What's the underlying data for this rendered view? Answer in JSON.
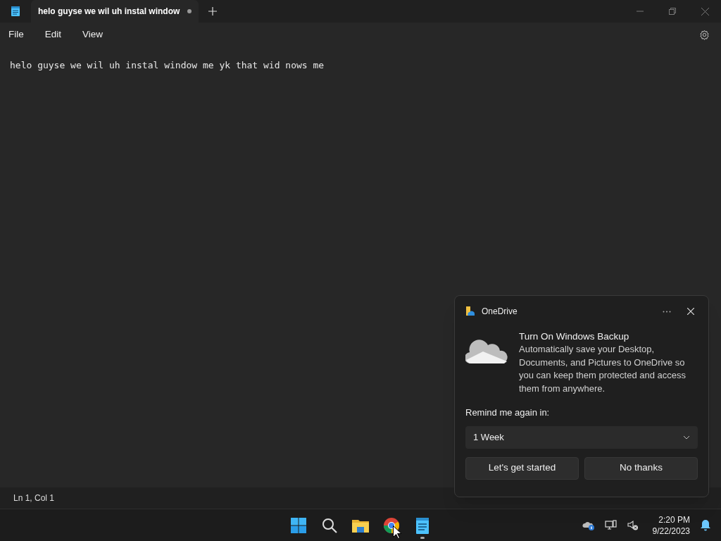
{
  "tab": {
    "title": "helo guyse we wil uh instal window",
    "unsaved": true
  },
  "menu": [
    "File",
    "Edit",
    "View"
  ],
  "editor": {
    "text": "helo guyse we wil uh instal window me yk that wid nows me"
  },
  "status_bar": [
    "Ln 1, Col 1"
  ],
  "notification": {
    "app": "OneDrive",
    "title": "Turn On Windows Backup",
    "body": "Automatically save your Desktop, Documents, and Pictures to OneDrive so you can keep them protected and access them from anywhere.",
    "remind_label": "Remind me again in:",
    "remind_value": "1 Week",
    "buttons": [
      "Let's get started",
      "No thanks"
    ]
  },
  "taskbar": {
    "apps": [
      {
        "kind": "start",
        "running": false
      },
      {
        "kind": "search",
        "running": false
      },
      {
        "kind": "explorer",
        "running": false
      },
      {
        "kind": "browser",
        "running": false
      },
      {
        "kind": "notepad",
        "running": true
      }
    ],
    "time": "2:20 PM",
    "date": "9/22/2023"
  }
}
